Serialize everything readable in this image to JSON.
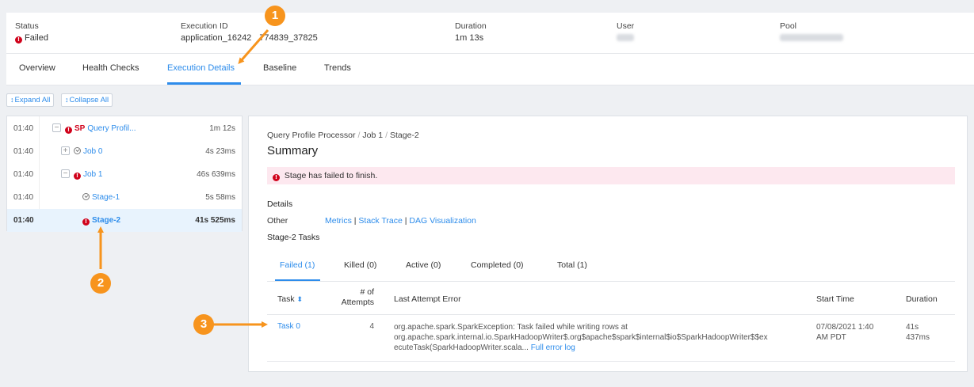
{
  "status_bar": {
    "status_label": "Status",
    "status_value": "Failed",
    "execution_id_label": "Execution ID",
    "execution_id_value": "application_16242",
    "execution_id_value_tail": "774839_37825",
    "duration_label": "Duration",
    "duration_value": "1m 13s",
    "user_label": "User",
    "pool_label": "Pool"
  },
  "tabs": [
    {
      "label": "Overview",
      "active": false
    },
    {
      "label": "Health Checks",
      "active": false
    },
    {
      "label": "Execution Details",
      "active": true
    },
    {
      "label": "Baseline",
      "active": false
    },
    {
      "label": "Trends",
      "active": false
    }
  ],
  "toolbar": {
    "expand_all": "Expand All",
    "collapse_all": "Collapse All"
  },
  "tree": [
    {
      "time": "01:40",
      "prefix": "SP",
      "label": "Query Profil...",
      "duration": "1m 12s",
      "state": "failed",
      "toggle": "−"
    },
    {
      "time": "01:40",
      "label": "Job 0",
      "duration": "4s 23ms",
      "state": "ok",
      "toggle": "+"
    },
    {
      "time": "01:40",
      "label": "Job 1",
      "duration": "46s 639ms",
      "state": "failed",
      "toggle": "−"
    },
    {
      "time": "01:40",
      "label": "Stage-1",
      "duration": "5s 58ms",
      "state": "ok"
    },
    {
      "time": "01:40",
      "label": "Stage-2",
      "duration": "41s 525ms",
      "state": "failed",
      "selected": true
    }
  ],
  "panel": {
    "breadcrumb": [
      "Query Profile Processor",
      "Job 1",
      "Stage-2"
    ],
    "title": "Summary",
    "alert": "Stage has failed to finish.",
    "details_heading": "Details",
    "other_label": "Other",
    "links": [
      "Metrics",
      "Stack Trace",
      "DAG Visualization"
    ],
    "tasks_heading": "Stage-2 Tasks",
    "subtabs": [
      {
        "label": "Failed (1)",
        "active": true
      },
      {
        "label": "Killed (0)",
        "active": false
      },
      {
        "label": "Active (0)",
        "active": false
      },
      {
        "label": "Completed (0)",
        "active": false
      },
      {
        "label": "Total (1)",
        "active": false
      }
    ],
    "table": {
      "headers": {
        "task": "Task",
        "attempts_line1": "# of",
        "attempts_line2": "Attempts",
        "error": "Last Attempt Error",
        "start": "Start Time",
        "duration": "Duration"
      },
      "rows": [
        {
          "task": "Task 0",
          "attempts": "4",
          "error_line1": "org.apache.spark.SparkException: Task failed while writing rows at",
          "error_line2": "org.apache.spark.internal.io.SparkHadoopWriter$.org$apache$spark$internal$io$SparkHadoopWriter$$ex",
          "error_line3": "ecuteTask(SparkHadoopWriter.scala...",
          "error_link": "Full error log",
          "start_line1": "07/08/2021 1:40",
          "start_line2": "AM PDT",
          "duration_line1": "41s",
          "duration_line2": "437ms"
        }
      ]
    }
  },
  "annotations": [
    "1",
    "2",
    "3"
  ],
  "colors": {
    "accent": "#2d8ceb",
    "error": "#d0021b",
    "annotation": "#f7941d",
    "alert_bg": "#fde8ef"
  }
}
